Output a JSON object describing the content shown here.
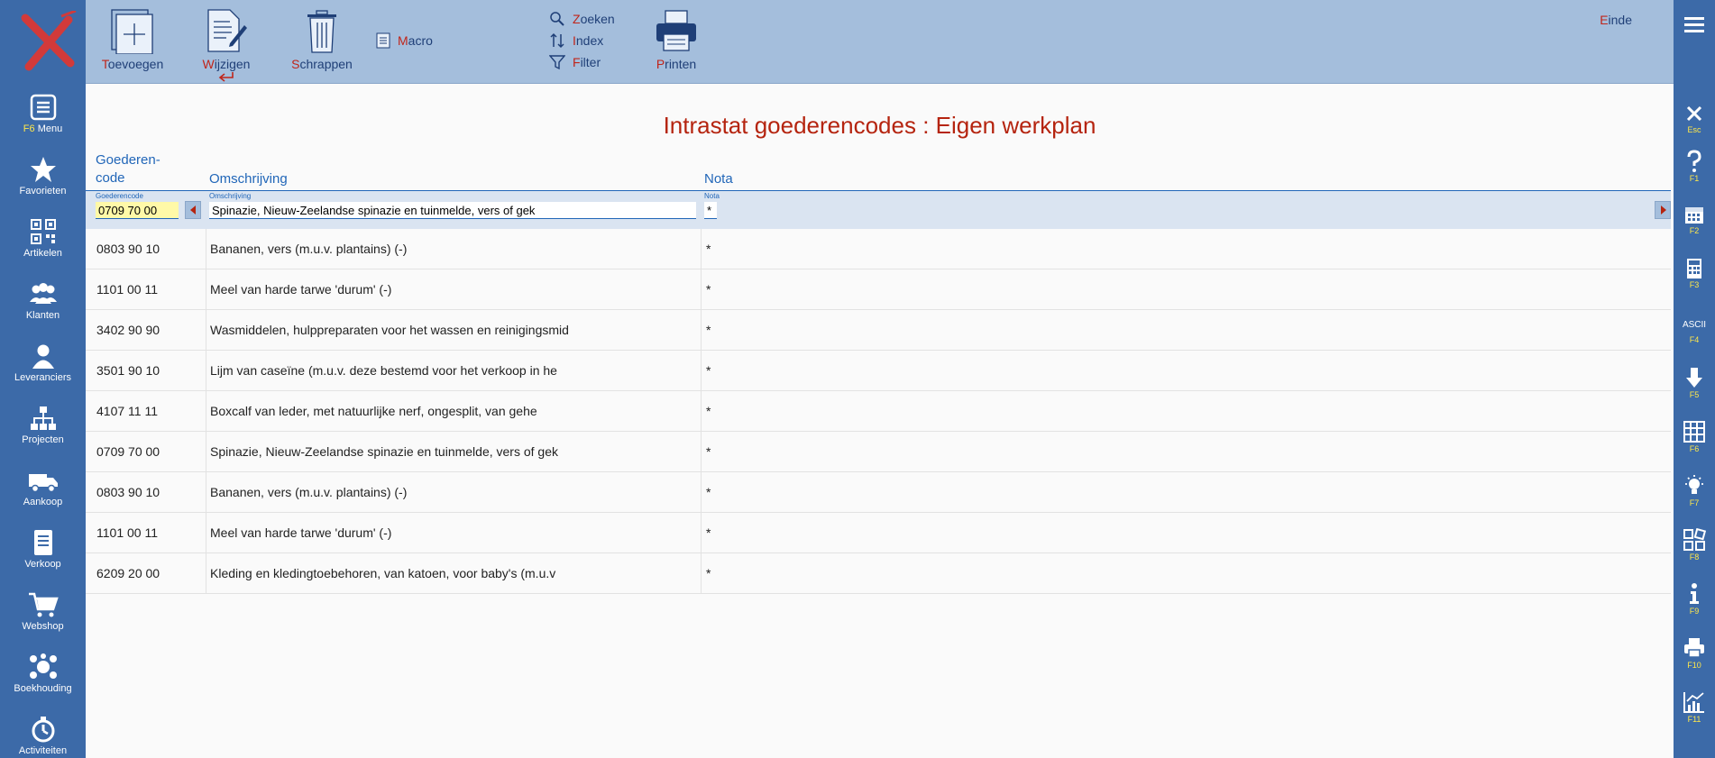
{
  "toolbar": {
    "add": {
      "first": "T",
      "rest": "oevoegen"
    },
    "edit": {
      "first": "W",
      "rest": "ijzigen"
    },
    "delete": {
      "first": "S",
      "rest": "chrappen"
    },
    "macro": {
      "first": "M",
      "rest": "acro"
    },
    "search": {
      "first": "Z",
      "rest": "oeken"
    },
    "index": {
      "first": "I",
      "rest": "ndex"
    },
    "filter": {
      "first": "F",
      "rest": "ilter"
    },
    "print": {
      "first": "P",
      "rest": "rinten"
    },
    "end": {
      "first": "E",
      "rest": "inde"
    }
  },
  "sidebar": {
    "menu_key": "F6",
    "menu_label": "Menu",
    "items": [
      "Favorieten",
      "Artikelen",
      "Klanten",
      "Leveranciers",
      "Projecten",
      "Aankoop",
      "Verkoop",
      "Webshop",
      "Boekhouding",
      "Activiteiten"
    ]
  },
  "fkeys": [
    "Esc",
    "F1",
    "F2",
    "F3",
    "F4",
    "F5",
    "F6",
    "F7",
    "F8",
    "F9",
    "F10",
    "F11"
  ],
  "fkey_ascii": "ASCII",
  "page": {
    "title": "Intrastat goederencodes : Eigen werkplan"
  },
  "table": {
    "headers": {
      "code_line1": "Goederen-",
      "code_line2": "code",
      "desc": "Omschrijving",
      "nota": "Nota"
    },
    "edit_labels": {
      "code": "Goederencode",
      "desc": "Omschrijving",
      "nota": "Nota"
    },
    "edit_values": {
      "code": "0709 70 00",
      "desc": "Spinazie, Nieuw-Zeelandse spinazie en tuinmelde, vers of gek",
      "nota": "*"
    },
    "rows": [
      {
        "code": "0803 90 10",
        "desc": "Bananen, vers (m.u.v. plantains) (-)",
        "nota": "*"
      },
      {
        "code": "1101 00 11",
        "desc": "Meel van harde tarwe 'durum' (-)",
        "nota": "*"
      },
      {
        "code": "3402 90 90",
        "desc": "Wasmiddelen, hulppreparaten voor het wassen en reinigingsmid",
        "nota": "*"
      },
      {
        "code": "3501 90 10",
        "desc": "Lijm van caseïne (m.u.v. deze bestemd voor het verkoop in he",
        "nota": "*"
      },
      {
        "code": "4107 11 11",
        "desc": "Boxcalf van leder, met natuurlijke nerf, ongesplit, van gehe",
        "nota": "*"
      },
      {
        "code": "0709 70 00",
        "desc": "Spinazie, Nieuw-Zeelandse spinazie en tuinmelde, vers of gek",
        "nota": "*"
      },
      {
        "code": "0803 90 10",
        "desc": "Bananen, vers (m.u.v. plantains) (-)",
        "nota": "*"
      },
      {
        "code": "1101 00 11",
        "desc": "Meel van harde tarwe 'durum' (-)",
        "nota": "*"
      },
      {
        "code": "6209 20 00",
        "desc": "Kleding en kledingtoebehoren, van katoen, voor baby's (m.u.v",
        "nota": "*"
      }
    ]
  },
  "colors": {
    "sidebar": "#3c6aa8",
    "toolbar": "#a4bedc",
    "accent_red": "#b5240f",
    "link_blue": "#2166b8",
    "highlight": "#fff9a8"
  }
}
